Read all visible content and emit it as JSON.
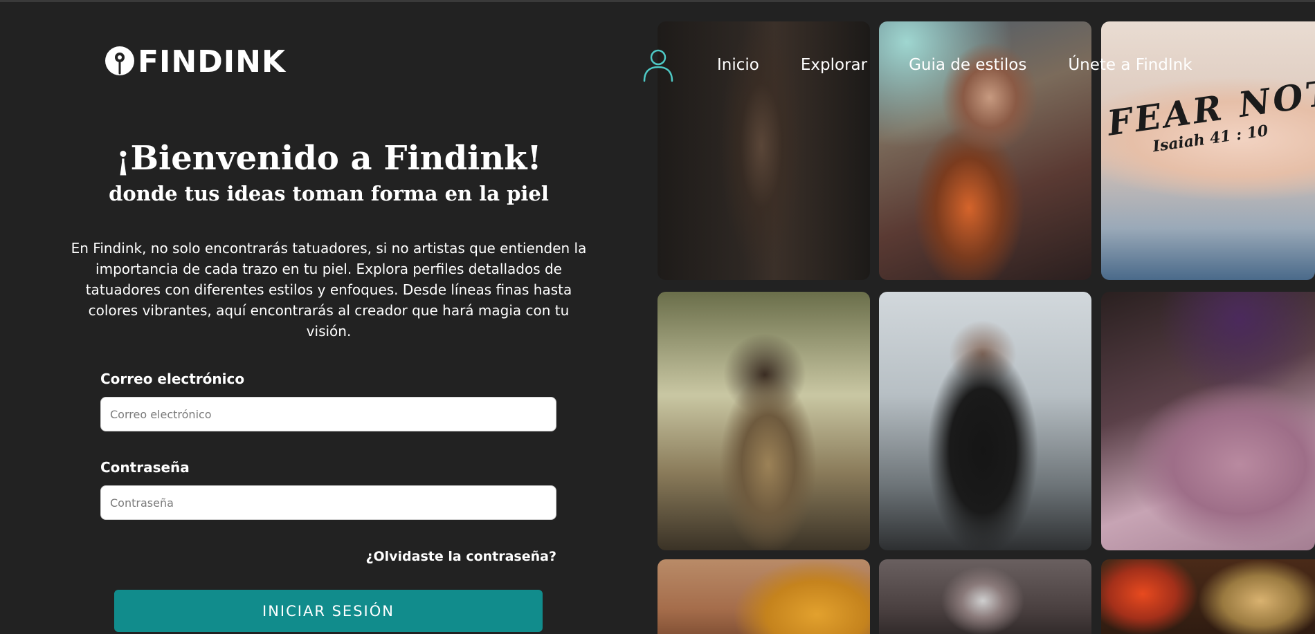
{
  "brand": {
    "logo_text": "FINDINK",
    "logo_icon": "map-pin-icon"
  },
  "nav": {
    "user_icon": "user-icon",
    "links": [
      "Inicio",
      "Explorar",
      "Guia de estilos",
      "Únete a FindInk"
    ],
    "accent_color": "#4ec9c5"
  },
  "hero": {
    "title": "¡Bienvenido a Findink!",
    "subtitle": "donde tus ideas toman forma en la piel",
    "description": "En Findink, no solo encontrarás tatuadores, si no artistas que entienden la importancia de cada trazo en tu piel. Explora perfiles detallados de tatuadores con diferentes estilos y enfoques. Desde líneas finas hasta colores vibrantes, aquí encontrarás al creador que hará magia con tu visión."
  },
  "login_form": {
    "email_label": "Correo electrónico",
    "email_placeholder": "Correo electrónico",
    "email_value": "",
    "password_label": "Contraseña",
    "password_placeholder": "Contraseña",
    "password_value": "",
    "forgot_password": "¿Olvidaste la contraseña?",
    "submit_label": "INICIAR SESIÓN",
    "submit_color": "#118c8c"
  },
  "gallery": {
    "tattoo_lettering": "FEAR NOT",
    "tattoo_reference": "Isaiah 41 : 10"
  },
  "theme": {
    "background": "#222222",
    "text": "#ffffff"
  }
}
